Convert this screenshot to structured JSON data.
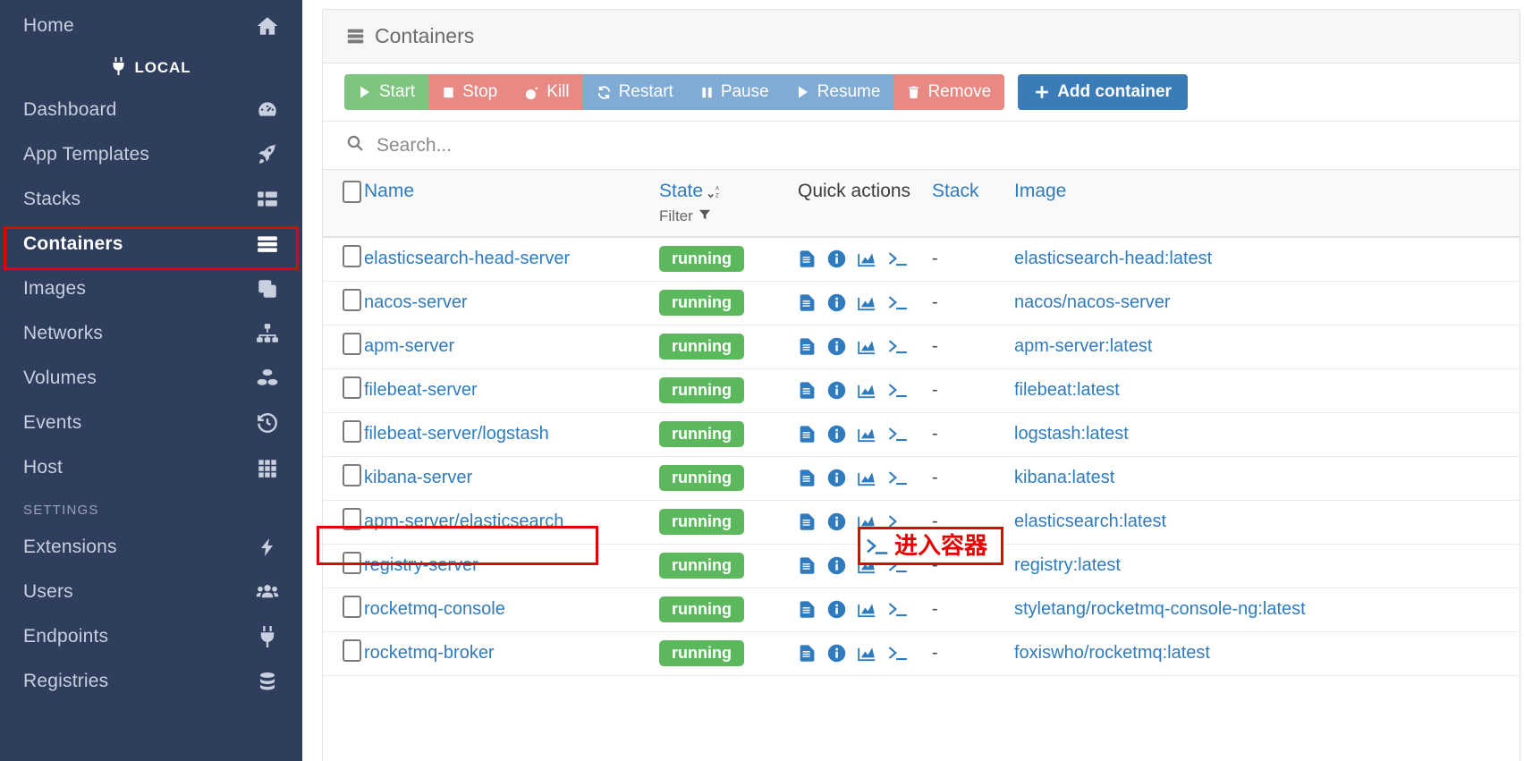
{
  "sidebar": {
    "home": {
      "label": "Home",
      "icon": "home-icon"
    },
    "endpoint_badge": {
      "label": "LOCAL",
      "icon": "plug-icon"
    },
    "items": [
      {
        "label": "Dashboard",
        "icon": "dashboard-icon"
      },
      {
        "label": "App Templates",
        "icon": "rocket-icon"
      },
      {
        "label": "Stacks",
        "icon": "stacks-icon"
      },
      {
        "label": "Containers",
        "icon": "containers-icon",
        "active": true
      },
      {
        "label": "Images",
        "icon": "images-icon"
      },
      {
        "label": "Networks",
        "icon": "networks-icon"
      },
      {
        "label": "Volumes",
        "icon": "volumes-icon"
      },
      {
        "label": "Events",
        "icon": "history-icon"
      },
      {
        "label": "Host",
        "icon": "grid-icon"
      }
    ],
    "settings_label": "SETTINGS",
    "settings_items": [
      {
        "label": "Extensions",
        "icon": "bolt-icon"
      },
      {
        "label": "Users",
        "icon": "users-icon"
      },
      {
        "label": "Endpoints",
        "icon": "plug-icon"
      },
      {
        "label": "Registries",
        "icon": "database-icon"
      }
    ]
  },
  "panel": {
    "title": "Containers",
    "title_icon": "server-stack-icon"
  },
  "toolbar": {
    "buttons": [
      {
        "label": "Start",
        "icon": "play-icon",
        "style": "green"
      },
      {
        "label": "Stop",
        "icon": "stop-icon",
        "style": "red"
      },
      {
        "label": "Kill",
        "icon": "bomb-icon",
        "style": "red"
      },
      {
        "label": "Restart",
        "icon": "sync-icon",
        "style": "blue"
      },
      {
        "label": "Pause",
        "icon": "pause-icon",
        "style": "blue"
      },
      {
        "label": "Resume",
        "icon": "play-icon",
        "style": "blue"
      },
      {
        "label": "Remove",
        "icon": "trash-icon",
        "style": "red"
      }
    ],
    "add_container": {
      "label": "Add container",
      "icon": "plus-icon"
    }
  },
  "search": {
    "placeholder": "Search...",
    "value": "",
    "icon": "search-icon"
  },
  "table": {
    "columns": {
      "name": "Name",
      "state": "State",
      "state_sort_icon": "sort-az-icon",
      "filter": "Filter",
      "filter_icon": "funnel-icon",
      "quick_actions": "Quick actions",
      "stack": "Stack",
      "image": "Image"
    },
    "action_icons": [
      "logs-icon",
      "info-icon",
      "stats-icon",
      "console-icon"
    ],
    "rows": [
      {
        "name": "elasticsearch-head-server",
        "state": "running",
        "stack": "-",
        "image": "elasticsearch-head:latest"
      },
      {
        "name": "nacos-server",
        "state": "running",
        "stack": "-",
        "image": "nacos/nacos-server"
      },
      {
        "name": "apm-server",
        "state": "running",
        "stack": "-",
        "image": "apm-server:latest"
      },
      {
        "name": "filebeat-server",
        "state": "running",
        "stack": "-",
        "image": "filebeat:latest"
      },
      {
        "name": "filebeat-server/logstash",
        "state": "running",
        "stack": "-",
        "image": "logstash:latest"
      },
      {
        "name": "kibana-server",
        "state": "running",
        "stack": "-",
        "image": "kibana:latest"
      },
      {
        "name": "apm-server/elasticsearch",
        "state": "running",
        "stack": "-",
        "image": "elasticsearch:latest"
      },
      {
        "name": "registry-server",
        "state": "running",
        "stack": "-",
        "image": "registry:latest"
      },
      {
        "name": "rocketmq-console",
        "state": "running",
        "stack": "-",
        "image": "styletang/rocketmq-console-ng:latest"
      },
      {
        "name": "rocketmq-broker",
        "state": "running",
        "stack": "-",
        "image": "foxiswho/rocketmq:latest"
      }
    ]
  },
  "annotations": {
    "exec_label": "进入容器",
    "highlight_color": "#e60000"
  },
  "colors": {
    "sidebar_bg": "#2f3e5d",
    "link_blue": "#2f7bbd",
    "running_green": "#5cb85c",
    "primary_blue": "#3a7cb8",
    "danger_red": "#e88984"
  }
}
